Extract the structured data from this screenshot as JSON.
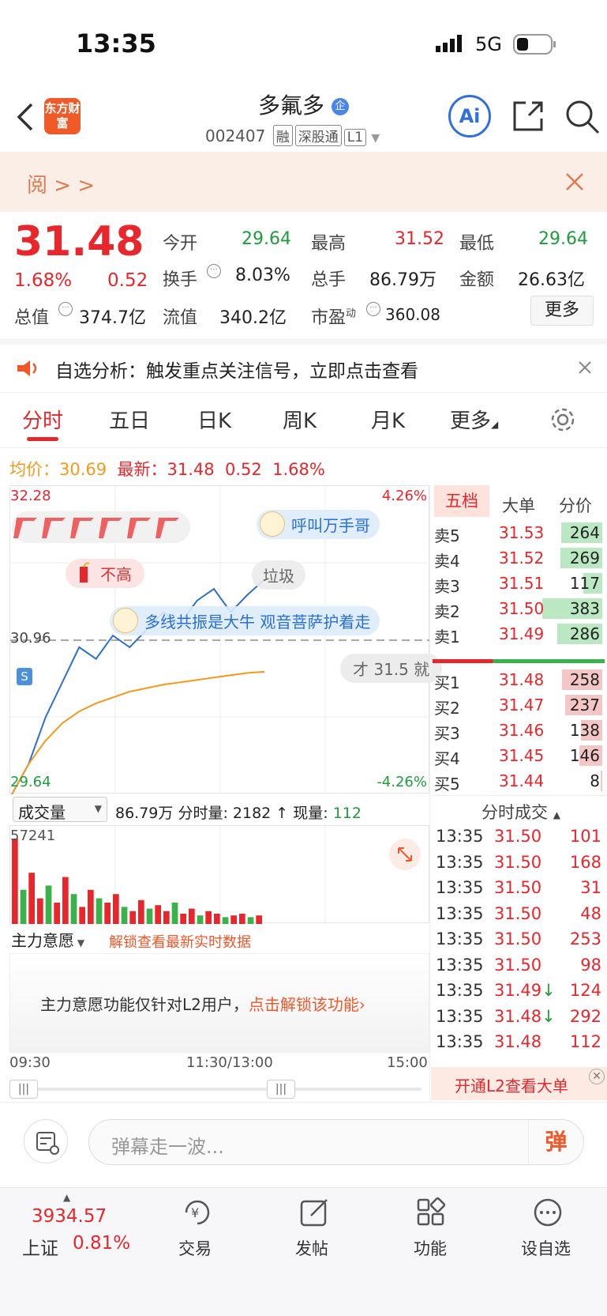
{
  "status": {
    "time": "13:35",
    "network": "5G"
  },
  "header": {
    "app_logo": "东方财富",
    "title": "多氟多",
    "title_badge": "企",
    "code": "002407",
    "tags": [
      "融",
      "深股通",
      "L1"
    ],
    "ai_label": "Ai"
  },
  "banner": {
    "text": "阅 > >"
  },
  "quote": {
    "price": "31.48",
    "change_pct": "1.68%",
    "change": "0.52",
    "fields": [
      {
        "label": "今开",
        "value": "29.64",
        "color": "green"
      },
      {
        "label": "最高",
        "value": "31.52",
        "color": "red"
      },
      {
        "label": "最低",
        "value": "29.64",
        "color": "green"
      },
      {
        "label": "换手",
        "value": "8.03%",
        "color": "dark"
      },
      {
        "label": "总手",
        "value": "86.79万",
        "color": "dark"
      },
      {
        "label": "金额",
        "value": "26.63亿",
        "color": "dark"
      },
      {
        "label": "总值",
        "value": "374.7亿",
        "color": "dark"
      },
      {
        "label": "流值",
        "value": "340.2亿",
        "color": "dark"
      },
      {
        "label": "市盈",
        "label_sup": "动",
        "value": "360.08",
        "color": "dark"
      }
    ],
    "more_button": "更多"
  },
  "notice": {
    "text": "自选分析：触发重点关注信号，立即点击查看"
  },
  "tabs": [
    "分时",
    "五日",
    "日K",
    "周K",
    "月K",
    "更多"
  ],
  "summary_line": {
    "avg_label": "均价：",
    "avg_value": "30.69",
    "latest_label": "最新：",
    "latest_value": "31.48",
    "change": "0.52",
    "change_pct": "1.68%"
  },
  "chart_data": {
    "type": "line",
    "series": [
      {
        "values": [
          29.64,
          29.9,
          30.3,
          30.6,
          30.9,
          30.8,
          31.0,
          30.9,
          31.05,
          31.2,
          31.1,
          31.3,
          31.4,
          31.2,
          31.35,
          31.48
        ]
      },
      {
        "values": [
          29.64,
          29.9,
          30.1,
          30.25,
          30.35,
          30.42,
          30.47,
          30.52,
          30.55,
          30.58,
          30.6,
          30.62,
          30.64,
          30.66,
          30.68,
          30.69
        ]
      }
    ],
    "y_max_label": "32.28",
    "y_mid_label": "30.96",
    "y_min_label": "29.64",
    "pct_max_label": "4.26%",
    "pct_min_label": "-4.26%",
    "x_labels": [
      "09:30",
      "11:30/13:00",
      "15:00"
    ],
    "ylim": [
      29.64,
      32.28
    ]
  },
  "overlays": {
    "bubble1": "呼叫万手哥",
    "bubble2": "不高",
    "bubble3": "垃圾",
    "bubble4": "多线共振是大牛 观音菩萨护着走",
    "bubble5": "才 31.5 就",
    "signal": "S"
  },
  "volume": {
    "selector": "成交量",
    "total": "86.79万",
    "tick_label": "分时量: 2182",
    "current_label": "现量:",
    "current_value": "112",
    "max_label": "57241",
    "bars": [
      100,
      40,
      60,
      30,
      45,
      25,
      55,
      35,
      20,
      40,
      30,
      25,
      35,
      20,
      15,
      28,
      18,
      22,
      15,
      25,
      12,
      18,
      10,
      15,
      12,
      8,
      10,
      12,
      8,
      10
    ]
  },
  "main_force": {
    "selector": "主力意愿",
    "unlock_hint": "解锁查看最新实时数据",
    "msg": "主力意愿功能仅针对L2用户，",
    "link": "点击解锁该功能"
  },
  "orderbook": {
    "tabs": [
      "五档",
      "大单",
      "分价"
    ],
    "asks": [
      {
        "label": "卖5",
        "price": "31.53",
        "vol": "264",
        "bar": 0.69
      },
      {
        "label": "卖4",
        "price": "31.52",
        "vol": "269",
        "bar": 0.7
      },
      {
        "label": "卖3",
        "price": "31.51",
        "vol": "117",
        "bar": 0.31
      },
      {
        "label": "卖2",
        "price": "31.50",
        "vol": "383",
        "bar": 1.0
      },
      {
        "label": "卖1",
        "price": "31.49",
        "vol": "286",
        "bar": 0.75
      }
    ],
    "bids": [
      {
        "label": "买1",
        "price": "31.48",
        "vol": "258",
        "bar": 0.67
      },
      {
        "label": "买2",
        "price": "31.47",
        "vol": "237",
        "bar": 0.62
      },
      {
        "label": "买3",
        "price": "31.46",
        "vol": "138",
        "bar": 0.36
      },
      {
        "label": "买4",
        "price": "31.45",
        "vol": "146",
        "bar": 0.38
      },
      {
        "label": "买5",
        "price": "31.44",
        "vol": "8",
        "bar": 0.02
      }
    ]
  },
  "trades": {
    "title": "分时成交",
    "rows": [
      {
        "time": "13:35",
        "price": "31.50",
        "vol": "101",
        "arrow": ""
      },
      {
        "time": "13:35",
        "price": "31.50",
        "vol": "168",
        "arrow": ""
      },
      {
        "time": "13:35",
        "price": "31.50",
        "vol": "31",
        "arrow": ""
      },
      {
        "time": "13:35",
        "price": "31.50",
        "vol": "48",
        "arrow": ""
      },
      {
        "time": "13:35",
        "price": "31.50",
        "vol": "253",
        "arrow": ""
      },
      {
        "time": "13:35",
        "price": "31.50",
        "vol": "98",
        "arrow": ""
      },
      {
        "time": "13:35",
        "price": "31.49",
        "vol": "124",
        "arrow": "↓"
      },
      {
        "time": "13:35",
        "price": "31.48",
        "vol": "292",
        "arrow": "↓"
      },
      {
        "time": "13:35",
        "price": "31.48",
        "vol": "112",
        "arrow": ""
      }
    ],
    "l2_banner": "开通L2查看大单"
  },
  "danmaku": {
    "placeholder": "弹幕走一波...",
    "send": "弹"
  },
  "bottom": {
    "index_value": "3934.57",
    "index_name": "上证",
    "index_pct": "0.81%",
    "items": [
      "交易",
      "发帖",
      "功能",
      "设自选"
    ]
  }
}
